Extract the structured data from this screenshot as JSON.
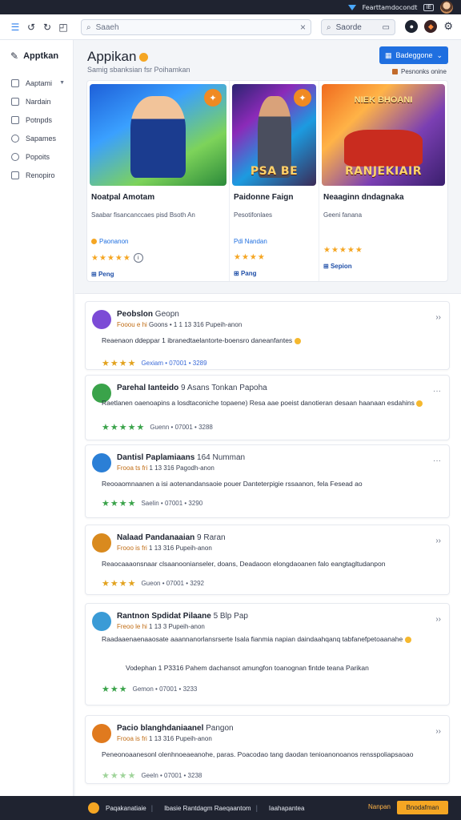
{
  "statusbar": {
    "title": "Fearttamdocondt",
    "battery": "IE"
  },
  "toolbar": {
    "search_placeholder": "Saaeh",
    "search2_placeholder": "Saorde"
  },
  "sidebar": {
    "brand": "Apptkan",
    "items": [
      {
        "label": "Aaptami",
        "icon": "box-icon"
      },
      {
        "label": "Nardain",
        "icon": "list-icon"
      },
      {
        "label": "Potnpds",
        "icon": "doc-icon"
      },
      {
        "label": "Sapames",
        "icon": "clock-icon"
      },
      {
        "label": "Popoits",
        "icon": "info-icon"
      },
      {
        "label": "Renopiro",
        "icon": "file-icon"
      }
    ]
  },
  "header": {
    "title": "Appikan",
    "subtitle": "Samig sbanksian fsr Poihamkan",
    "primary_button": "Badeggone",
    "right_note": "Pesnonks onine"
  },
  "featured": [
    {
      "title": "Noatpal Amotam",
      "desc": "Saabar fisancanccaes pisd Bsoth An",
      "meta": "Paonanon",
      "stars": "★★★★★",
      "link": "Peng",
      "art_top": "",
      "art_bottom": ""
    },
    {
      "title": "Paidonne Faign",
      "desc": "Pesotifonlaes",
      "meta": "Pdi Nandan",
      "stars": "★★★★",
      "link": "Pang",
      "art_top": "",
      "art_bottom": "PSA BE"
    },
    {
      "title": "Neaaginn dndagnaka",
      "desc": "Geeni fanana",
      "meta": "",
      "stars": "★★★★★",
      "link": "Sepion",
      "art_top": "NIEK BHOANI",
      "art_bottom": "RANJEKIAIR"
    }
  ],
  "reviews": [
    {
      "name": "Peobslon",
      "name_suffix": "Geopn",
      "meta_a": "Fooou e hi",
      "meta_b": "Goons • 1 1 13 316 Pupeih-anon",
      "body": "Reaenaon ddeppar 1 ibranedtaelantorte-boensro daneanfantes",
      "stars": "★★★★",
      "foot": "Gexiam • 07001 • 3289",
      "avatar": "#7c4bd6"
    },
    {
      "name": "Parehal Ianteido",
      "name_suffix": "9 Asans Tonkan Papoha",
      "meta_a": "",
      "meta_b": "",
      "body": "Raetlanen oaenoapins a losdtaconiche topaene) Resa aae poeist danotieran desaan haanaan esdahins",
      "stars": "★★★★★",
      "foot": "Guenn • 07001 • 3288",
      "avatar": "#3aa34a"
    },
    {
      "name": "Dantisl Paplamiaans",
      "name_suffix": "164 Numman",
      "meta_a": "Frooa ts fri",
      "meta_b": "1 13 316 Pagodh-anon",
      "body": "Reooaomnaanen a isi aotenandansaoie pouer Danteterpigie rssaanon, fela Fesead ao",
      "stars": "★★★★",
      "foot": "Saelin • 07001 • 3290",
      "avatar": "#2b7fd6"
    },
    {
      "name": "Nalaad Pandanaaian",
      "name_suffix": "9 Raran",
      "meta_a": "Frooo is fri",
      "meta_b": "1 13 316 Pupeih-anon",
      "body": "Reaocaaaonsnaar clsaanoonianseler, doans, Deadaoon elongdaoanen falo eangtagltudanpon",
      "stars": "★★★★",
      "foot": "Gueon • 07001 • 3292",
      "avatar": "#d98a1e"
    },
    {
      "name": "Rantnon Spdidat Pilaane",
      "name_suffix": "5 Blp Pap",
      "meta_a": "Freoo le hi",
      "meta_b": "1 13 3 Pupeih-anon",
      "body": "Raadaaenaenaaosate aaannanorlansrserte Isala fianmia napian daindaahqanq tabfanefpetoaanahe",
      "body2": "Vodephan 1 P3316 Pahem dachansot amungfon toanognan fintde teana Parikan",
      "stars": "★★★",
      "foot": "Gemon • 07001 • 3233",
      "avatar": "#3a9bd6"
    },
    {
      "name": "Pacio blanghdaniaanel",
      "name_suffix": "Pangon",
      "meta_a": "Frooa is fri",
      "meta_b": "1 13 316 Pupeih-anon",
      "body": "Peneonoaanesonl olenhnoeaeanohe, paras. Poacodao tang daodan tenioanonoanos rensspoliapsaoao",
      "stars": "★★★★",
      "foot": "Geeln • 07001 • 3238",
      "avatar": "#e07a1e"
    }
  ],
  "bottombar": {
    "text1": "Paqakanatiaie",
    "text2": "Ibasie Rantdagm Raeqaantom",
    "text3": "Iaahapantea",
    "right_text": "Nanpan",
    "button": "Bnodafman"
  }
}
